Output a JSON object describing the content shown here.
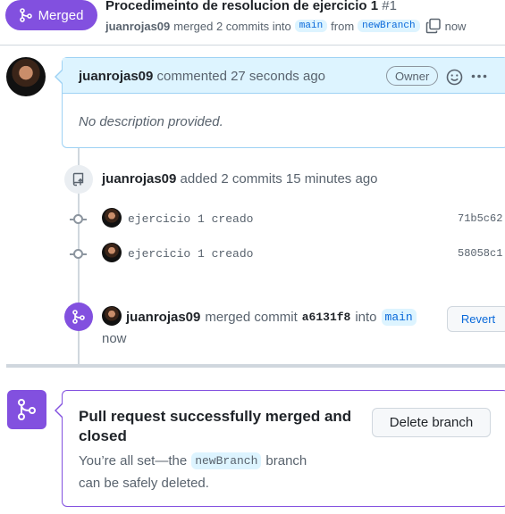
{
  "header": {
    "status_label": "Merged",
    "title": "Procedimeinto de resolucion de ejercicio 1",
    "number": "#1",
    "author": "juanrojas09",
    "merged_text": "merged 2 commits into",
    "base_branch": "main",
    "from_text": "from",
    "head_branch": "newBranch",
    "time": "now"
  },
  "comment": {
    "author": "juanrojas09",
    "action": "commented 27 seconds ago",
    "role_badge": "Owner",
    "body": "No description provided."
  },
  "commits_event": {
    "author": "juanrojas09",
    "action": "added 2 commits 15 minutes ago",
    "commits": [
      {
        "message": "ejercicio 1 creado",
        "sha": "71b5c62"
      },
      {
        "message": "ejercicio 1 creado",
        "sha": "58058c1"
      }
    ]
  },
  "merge_event": {
    "author": "juanrojas09",
    "action": "merged commit",
    "sha": "a6131f8",
    "into_text": "into",
    "branch": "main",
    "time": "now",
    "revert_label": "Revert"
  },
  "merge_box": {
    "title": "Pull request successfully merged and closed",
    "desc_prefix": "You’re all set—the",
    "branch": "newBranch",
    "desc_suffix": "branch",
    "desc_line2": "can be safely deleted.",
    "delete_label": "Delete branch"
  },
  "colors": {
    "merged_purple": "#8250df",
    "link_blue": "#0969da",
    "comment_header_bg": "#ddf4ff"
  }
}
